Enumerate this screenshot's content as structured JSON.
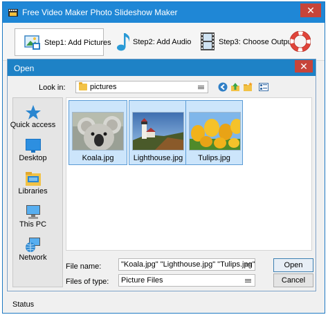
{
  "app": {
    "title": "Free Video Maker Photo Slideshow Maker",
    "close_icon": "✕"
  },
  "toolbar": {
    "step1_label": "Step1: Add Pictures",
    "step2_label": "Step2: Add Audio",
    "step3_label": "Step3: Choose Output",
    "step1_icon": "picture-icon",
    "step2_icon": "music-note-icon",
    "step3_icon": "film-strip-icon",
    "help_icon": "lifebuoy-icon"
  },
  "dialog": {
    "title": "Open",
    "close_icon": "✕",
    "look_in_label": "Look in:",
    "look_in_value": "pictures",
    "places": [
      {
        "label": "Quick access",
        "icon": "star-icon"
      },
      {
        "label": "Desktop",
        "icon": "desktop-icon"
      },
      {
        "label": "Libraries",
        "icon": "libraries-icon"
      },
      {
        "label": "This PC",
        "icon": "computer-icon"
      },
      {
        "label": "Network",
        "icon": "network-icon"
      }
    ],
    "files": [
      {
        "name": "Koala.jpg",
        "selected": true
      },
      {
        "name": "Lighthouse.jpg",
        "selected": true
      },
      {
        "name": "Tulips.jpg",
        "selected": true
      }
    ],
    "file_name_label": "File name:",
    "file_name_value": "\"Koala.jpg\" \"Lighthouse.jpg\" \"Tulips.jpg\"",
    "file_type_label": "Files of type:",
    "file_type_value": "Picture Files",
    "open_button": "Open",
    "cancel_button": "Cancel"
  },
  "status": {
    "label": "Status"
  },
  "colors": {
    "titlebar": "#1f87d6",
    "close": "#c7443a",
    "selection": "#cce5fb"
  }
}
